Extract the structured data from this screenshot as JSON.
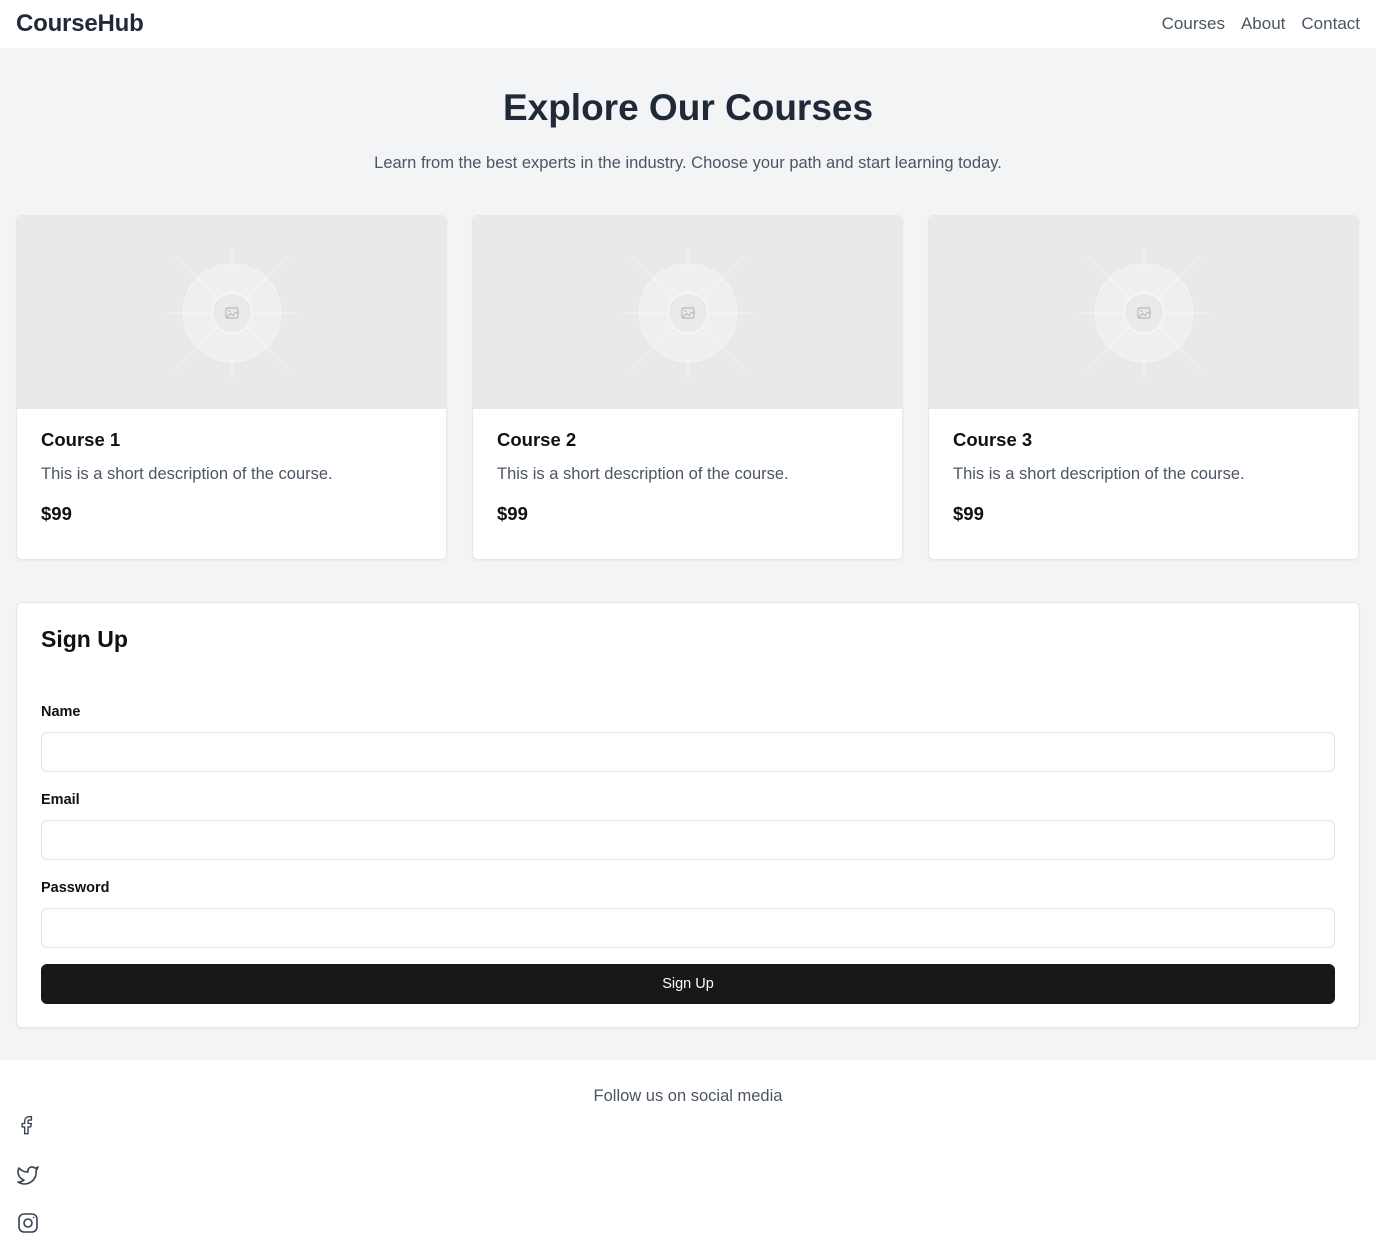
{
  "header": {
    "brand": "CourseHub",
    "nav": [
      "Courses",
      "About",
      "Contact"
    ]
  },
  "hero": {
    "title": "Explore Our Courses",
    "subtitle": "Learn from the best experts in the industry. Choose your path and start learning today."
  },
  "courses": [
    {
      "title": "Course 1",
      "description": "This is a short description of the course.",
      "price": "$99",
      "image_icon": "image-placeholder-icon"
    },
    {
      "title": "Course 2",
      "description": "This is a short description of the course.",
      "price": "$99",
      "image_icon": "image-placeholder-icon"
    },
    {
      "title": "Course 3",
      "description": "This is a short description of the course.",
      "price": "$99",
      "image_icon": "image-placeholder-icon"
    }
  ],
  "signup": {
    "title": "Sign Up",
    "fields": [
      {
        "label": "Name",
        "value": "",
        "placeholder": ""
      },
      {
        "label": "Email",
        "value": "",
        "placeholder": ""
      },
      {
        "label": "Password",
        "value": "",
        "placeholder": ""
      }
    ],
    "submit_label": "Sign Up"
  },
  "footer": {
    "text": "Follow us on social media",
    "social_icons": [
      "facebook-icon",
      "twitter-icon",
      "instagram-icon"
    ]
  },
  "colors": {
    "page_background": "#f3f4f6",
    "card_background": "#ffffff",
    "placeholder_background": "#e9e9e9",
    "primary_button": "#18181b",
    "heading_text": "#1f2937",
    "muted_text": "#4b5563"
  }
}
